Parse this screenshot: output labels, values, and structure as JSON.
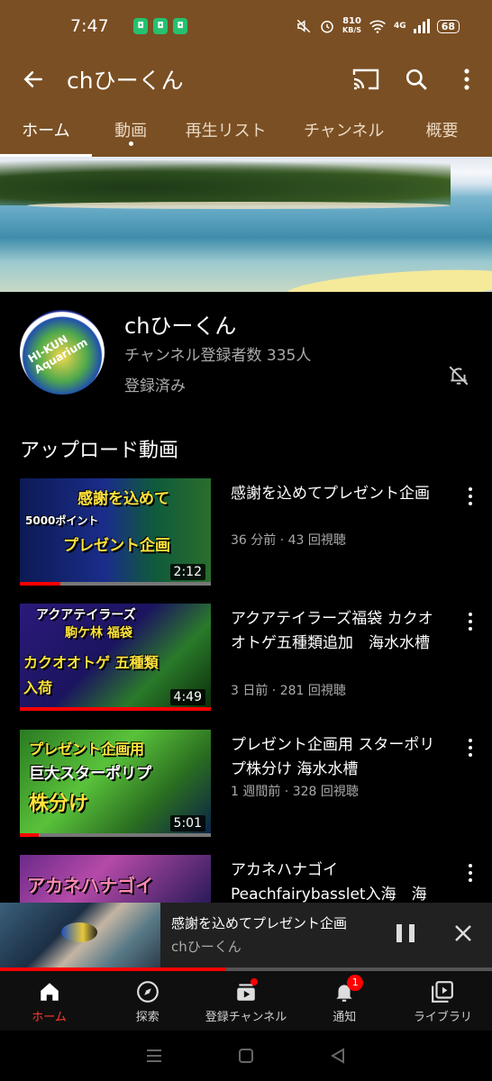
{
  "status_bar": {
    "time": "7:47",
    "speed_top": "810",
    "speed_bottom": "KB/S",
    "network": "4G",
    "battery": "68"
  },
  "app_bar": {
    "title": "chひーくん"
  },
  "tabs": [
    {
      "label": "ホーム",
      "active": true
    },
    {
      "label": "動画",
      "active": false
    },
    {
      "label": "再生リスト",
      "active": false
    },
    {
      "label": "チャンネル",
      "active": false
    },
    {
      "label": "概要",
      "active": false
    }
  ],
  "channel": {
    "name": "chひーくん",
    "subscribers": "チャンネル登録者数 335人",
    "subscribed_label": "登録済み",
    "avatar_text": "HI-KUN Aquarium"
  },
  "section_title": "アップロード動画",
  "videos": [
    {
      "thumb_caption_1": "感謝を込めて",
      "thumb_caption_2": "5000ポイント",
      "thumb_caption_3": "プレゼント企画",
      "duration": "2:12",
      "progress": 0.21,
      "title": "感謝を込めてプレゼント企画",
      "meta": "36 分前 · 43 回視聴"
    },
    {
      "thumb_caption_1": "アクアテイラーズ",
      "thumb_caption_2": "駒ケ林 福袋",
      "thumb_caption_3": "カクオオトゲ 五種類 入荷",
      "duration": "4:49",
      "progress": 1.0,
      "title": "アクアテイラーズ福袋 カクオオトゲ五種類追加　海水水槽",
      "meta": "3 日前 · 281 回視聴"
    },
    {
      "thumb_caption_1": "プレゼント企画用",
      "thumb_caption_2": "巨大スターポリプ",
      "thumb_caption_3": "株分け",
      "duration": "5:01",
      "progress": 0.1,
      "title": "プレゼント企画用 スターポリプ株分け 海水水槽",
      "meta": "1 週間前 · 328 回視聴"
    },
    {
      "thumb_caption_1": "アカネハナゴイ",
      "title": "アカネハナゴイ Peachfairybasslet入海　海水"
    }
  ],
  "mini_player": {
    "title": "感謝を込めてプレゼント企画",
    "channel": "chひーくん",
    "progress": 0.46
  },
  "bottom_nav": [
    {
      "label": "ホーム",
      "icon": "home-icon",
      "active": true
    },
    {
      "label": "探索",
      "icon": "explore-icon",
      "active": false
    },
    {
      "label": "登録チャンネル",
      "icon": "subscriptions-icon",
      "active": false,
      "dot": true
    },
    {
      "label": "通知",
      "icon": "bell-icon",
      "active": false,
      "badge": "1"
    },
    {
      "label": "ライブラリ",
      "icon": "library-icon",
      "active": false
    }
  ],
  "colors": {
    "header_brown": "#7a4f23",
    "accent_red": "#ff0000"
  }
}
